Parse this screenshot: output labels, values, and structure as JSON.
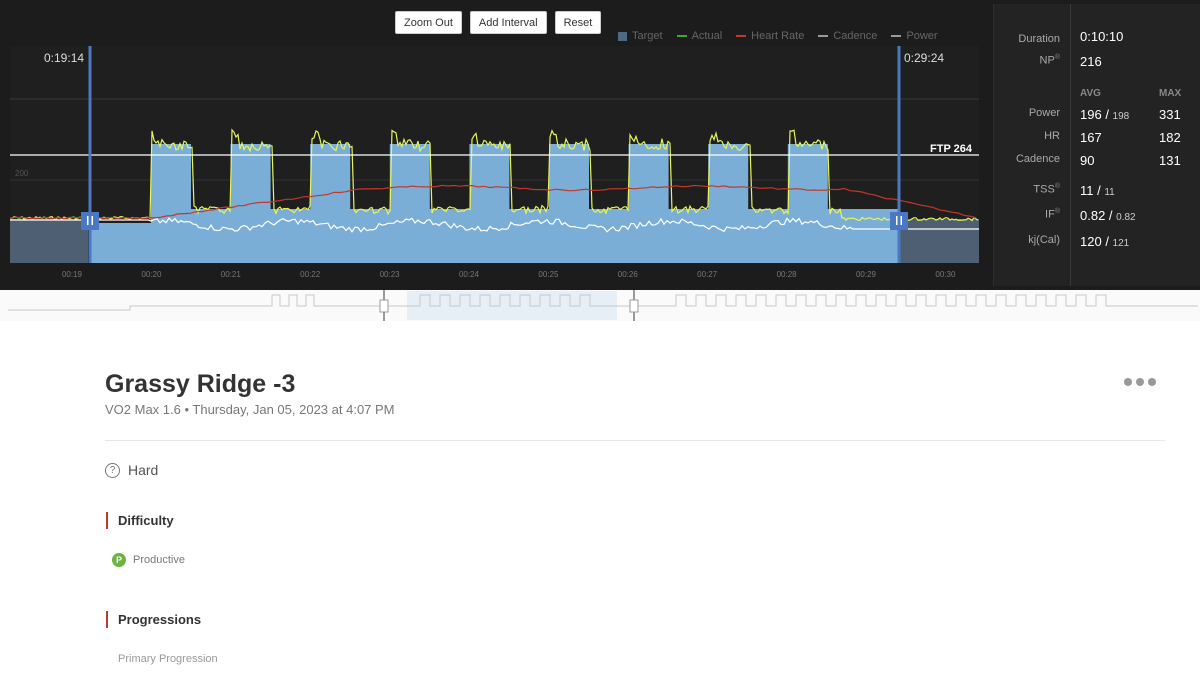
{
  "toolbar": {
    "zoom_out": "Zoom Out",
    "add_interval": "Add Interval",
    "reset": "Reset"
  },
  "legend": [
    {
      "label": "Target",
      "color": "#4d6a86",
      "kind": "square"
    },
    {
      "label": "Actual",
      "color": "#3fa535",
      "kind": "line"
    },
    {
      "label": "Heart Rate",
      "color": "#c0392b",
      "kind": "line"
    },
    {
      "label": "Cadence",
      "color": "#999999",
      "kind": "line"
    },
    {
      "label": "Power",
      "color": "#999999",
      "kind": "line"
    }
  ],
  "chart": {
    "left_time": "0:19:14",
    "right_time": "0:29:24",
    "ftp_label": "FTP 264",
    "y_tick": "200",
    "x_ticks": [
      "00:19",
      "00:20",
      "00:21",
      "00:22",
      "00:23",
      "00:24",
      "00:25",
      "00:26",
      "00:27",
      "00:28",
      "00:29",
      "00:30"
    ],
    "handle_icon": "pause-icon"
  },
  "chart_data": {
    "type": "area",
    "title": "",
    "xlabel": "",
    "ylabel": "",
    "x_ticks": [
      "00:19",
      "00:20",
      "00:21",
      "00:22",
      "00:23",
      "00:24",
      "00:25",
      "00:26",
      "00:27",
      "00:28",
      "00:29",
      "00:30"
    ],
    "ftp": 264,
    "intervals_on": 9,
    "on_power_watts": 264,
    "off_power_watts": 175,
    "selection": {
      "start": "0:19:14",
      "end": "0:29:24"
    }
  },
  "stats": {
    "duration_label": "Duration",
    "duration": "0:10:10",
    "np_label": "NP",
    "np": "216",
    "avg_head": "AVG",
    "max_head": "MAX",
    "rows": [
      {
        "label": "Power",
        "avg": "196",
        "avg2": "198",
        "max": "331"
      },
      {
        "label": "HR",
        "avg": "167",
        "avg2": "",
        "max": "182"
      },
      {
        "label": "Cadence",
        "avg": "90",
        "avg2": "",
        "max": "131"
      }
    ],
    "tss_label": "TSS",
    "tss": "11",
    "tss2": "11",
    "if_label": "IF",
    "if": "0.82",
    "if2": "0.82",
    "kj_label": "kj(Cal)",
    "kj": "120",
    "kj2": "121"
  },
  "workout": {
    "title": "Grassy Ridge -3",
    "subtitle": "VO2 Max 1.6 • Thursday, Jan 05, 2023 at 4:07 PM",
    "feel": "Hard",
    "difficulty_title": "Difficulty",
    "difficulty_badge": "P",
    "difficulty_value": "Productive",
    "progressions_title": "Progressions",
    "primary_progression": "Primary Progression"
  },
  "colors": {
    "accent": "#c0392b",
    "target": "#7fb6e0",
    "actual": "#e6f55a",
    "selection": "#4a78c2"
  }
}
